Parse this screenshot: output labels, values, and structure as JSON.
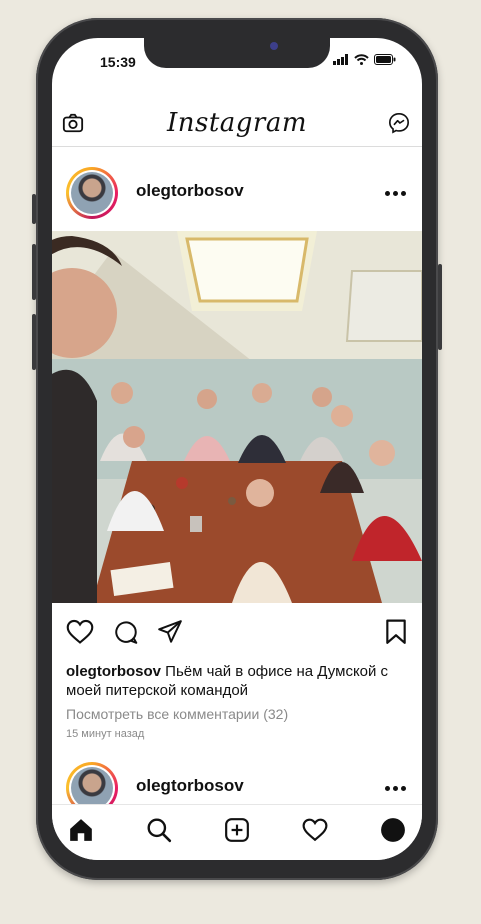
{
  "status_bar": {
    "time": "15:39"
  },
  "header": {
    "brand": "Instagram",
    "left_icon": "camera-icon",
    "right_icon": "messenger-icon"
  },
  "post": {
    "username": "olegtorbosov",
    "caption_text": " Пьём чай в офисе на Думской с моей питерской командой",
    "view_comments": "Посмотреть все комментарии (32)",
    "time_ago": "15 минут назад",
    "actions": [
      "heart-icon",
      "comment-icon",
      "share-icon",
      "bookmark-icon"
    ]
  },
  "next_post": {
    "username": "olegtorbosov"
  },
  "tabbar": {
    "items": [
      "home-icon",
      "search-icon",
      "add-icon",
      "heart-icon",
      "profile-icon"
    ]
  },
  "colors": {
    "background": "#ece9df",
    "phone_frame": "#2c2c2e",
    "story_ring": "#e91e63"
  }
}
